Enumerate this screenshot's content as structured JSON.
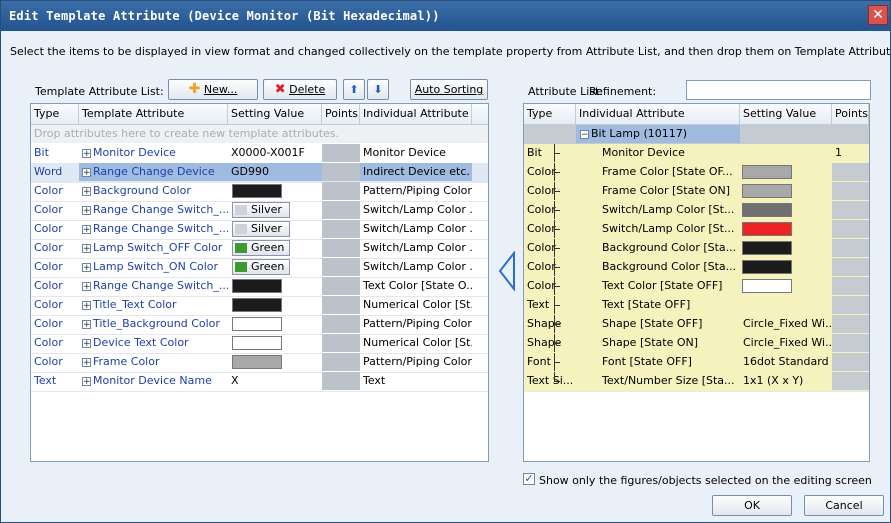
{
  "window": {
    "title": "Edit Template Attribute (Device Monitor (Bit Hexadecimal))",
    "close": "✕"
  },
  "instruction": "Select the items to be displayed in view format and changed collectively on the template property from Attribute List, and then drop them on Template Attribute List.",
  "left": {
    "label": "Template Attribute List:",
    "buttons": {
      "new": "New...",
      "delete": "Delete",
      "up": "⬆",
      "down": "⬇",
      "auto_sort": "Auto Sorting"
    },
    "columns": [
      "Type",
      "Template Attribute",
      "Setting Value",
      "Points",
      "Individual Attribute"
    ],
    "drop_hint": "Drop attributes here to create new template attributes.",
    "rows": [
      {
        "type": "Bit",
        "attr": "Monitor Device",
        "value": "X0000-X001F",
        "individual": "Monitor Device"
      },
      {
        "type": "Word",
        "attr": "Range Change Device",
        "value": "GD990",
        "individual": "Indirect Device etc.",
        "selected": true
      },
      {
        "type": "Color",
        "attr": "Background Color",
        "swatch": "#1c1c1c",
        "individual": "Pattern/Piping Color"
      },
      {
        "type": "Color",
        "attr": "Range Change Switch_...",
        "named": "Silver",
        "chip": "#cfd3d8",
        "individual": "Switch/Lamp Color ..."
      },
      {
        "type": "Color",
        "attr": "Range Change Switch_...",
        "named": "Silver",
        "chip": "#cfd3d8",
        "individual": "Switch/Lamp Color ..."
      },
      {
        "type": "Color",
        "attr": "Lamp Switch_OFF Color",
        "named": "Green",
        "chip": "#3e9a2e",
        "individual": "Switch/Lamp Color ..."
      },
      {
        "type": "Color",
        "attr": "Lamp Switch_ON Color",
        "named": "Green",
        "chip": "#3e9a2e",
        "individual": "Switch/Lamp Color ..."
      },
      {
        "type": "Color",
        "attr": "Range Change Switch_...",
        "swatch": "#1c1c1c",
        "individual": "Text Color [State O..."
      },
      {
        "type": "Color",
        "attr": "Title_Text Color",
        "swatch": "#1c1c1c",
        "individual": "Numerical Color [St..."
      },
      {
        "type": "Color",
        "attr": "Title_Background Color",
        "swatch": "#ffffff",
        "individual": "Pattern/Piping Color"
      },
      {
        "type": "Color",
        "attr": "Device Text Color",
        "swatch": "#ffffff",
        "individual": "Numerical Color [St..."
      },
      {
        "type": "Color",
        "attr": "Frame Color",
        "swatch": "#a8a8a8",
        "individual": "Pattern/Piping Color"
      },
      {
        "type": "Text",
        "attr": "Monitor Device Name",
        "value": "X",
        "individual": "Text"
      }
    ]
  },
  "right": {
    "label": "Attribute List:",
    "refinement_label": "Refinement:",
    "refinement_value": "",
    "columns": [
      "Type",
      "Individual Attribute",
      "Setting Value",
      "Points"
    ],
    "group": "Bit Lamp (10117)",
    "rows": [
      {
        "type": "Bit",
        "attr": "Monitor Device",
        "value": "",
        "points": "1"
      },
      {
        "type": "Color",
        "attr": "Frame Color [State OF...",
        "swatch": "#a8a8a8"
      },
      {
        "type": "Color",
        "attr": "Frame Color [State ON]",
        "swatch": "#a8a8a8"
      },
      {
        "type": "Color",
        "attr": "Switch/Lamp Color [St...",
        "swatch": "#707070"
      },
      {
        "type": "Color",
        "attr": "Switch/Lamp Color [St...",
        "swatch": "#ee2222"
      },
      {
        "type": "Color",
        "attr": "Background Color [Sta...",
        "swatch": "#1c1c1c"
      },
      {
        "type": "Color",
        "attr": "Background Color [Sta...",
        "swatch": "#1c1c1c"
      },
      {
        "type": "Color",
        "attr": "Text Color [State OFF]",
        "swatch": "#ffffff"
      },
      {
        "type": "Text",
        "attr": "Text [State OFF]",
        "value": ""
      },
      {
        "type": "Shape",
        "attr": "Shape [State OFF]",
        "value": "Circle_Fixed Wi..."
      },
      {
        "type": "Shape",
        "attr": "Shape [State ON]",
        "value": "Circle_Fixed Wi..."
      },
      {
        "type": "Font",
        "attr": "Font [State OFF]",
        "value": "16dot Standard"
      },
      {
        "type": "Text Si...",
        "attr": "Text/Number Size [Sta...",
        "value": "1x1 (X x Y)"
      }
    ]
  },
  "footer": {
    "checkbox_label": "Show only the figures/objects selected on the editing screen",
    "checked": true,
    "ok": "OK",
    "cancel": "Cancel"
  }
}
